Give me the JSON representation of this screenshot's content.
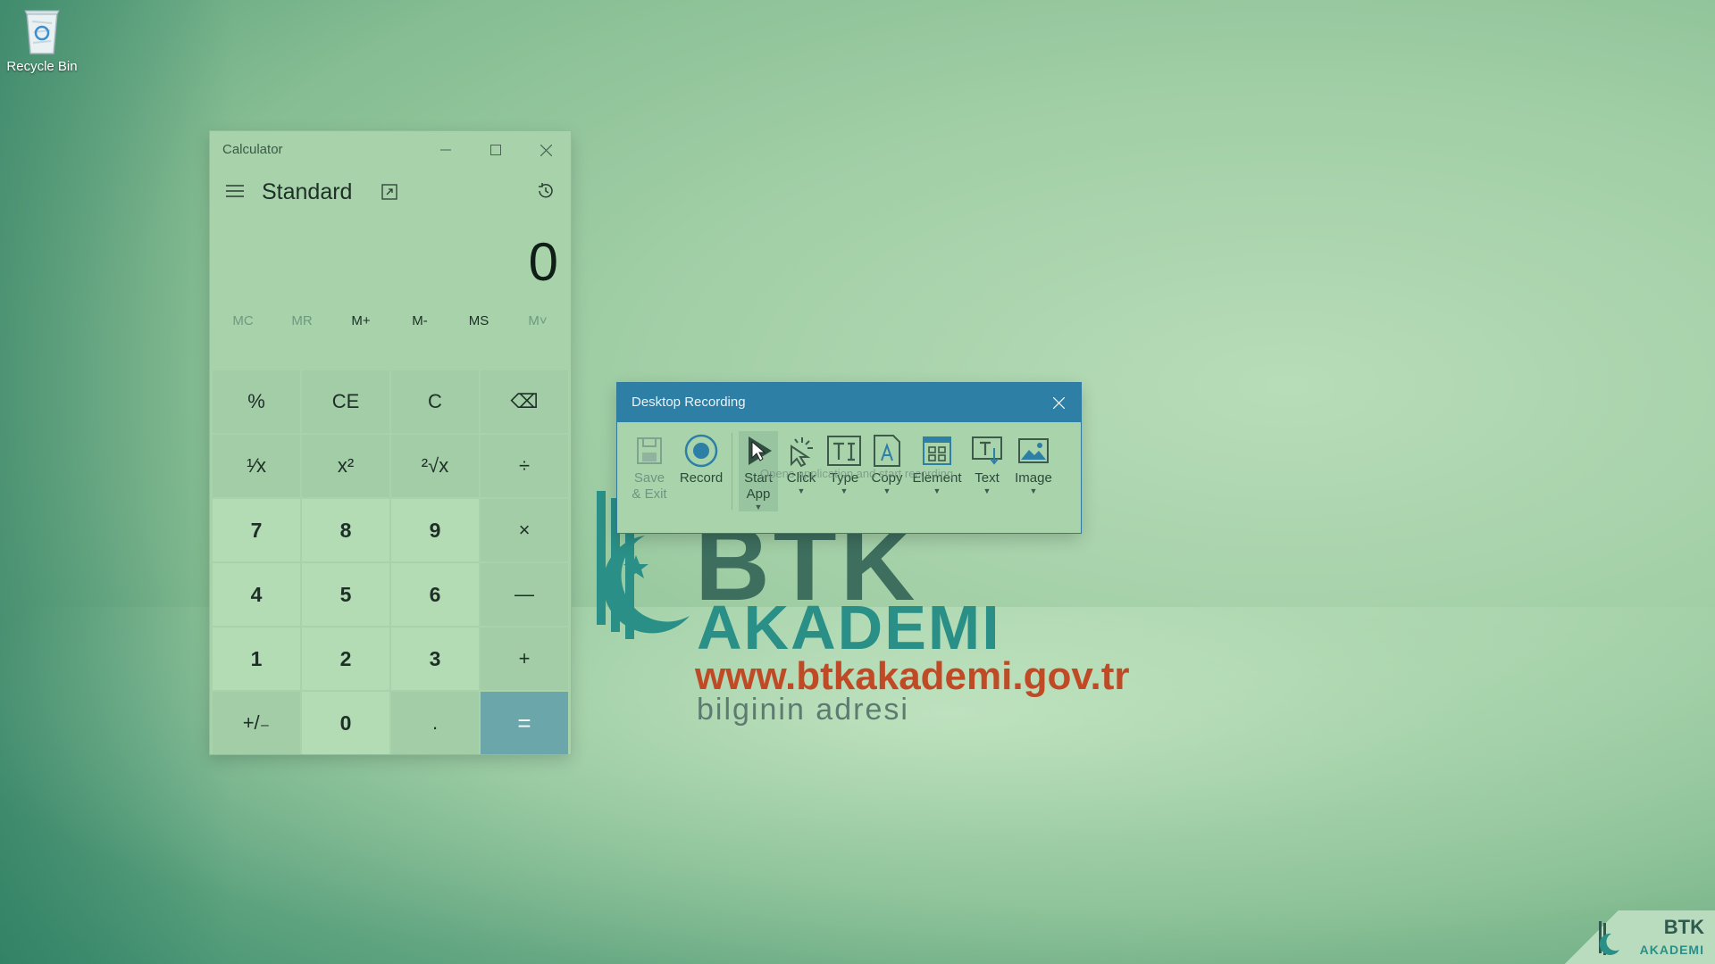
{
  "desktop": {
    "recycle_bin_label": "Recycle Bin"
  },
  "logo": {
    "btk": "BTK",
    "akademi": "AKADEMI",
    "url": "www.btkakademi.gov.tr",
    "slogan": "bilginin adresi"
  },
  "corner_logo": {
    "btk": "BTK",
    "akademi": "AKADEMI"
  },
  "calculator": {
    "title": "Calculator",
    "mode": "Standard",
    "display_value": "0",
    "memory": [
      "MC",
      "MR",
      "M+",
      "M-",
      "MS",
      "M˅"
    ],
    "keys": [
      {
        "label": "%",
        "type": "op"
      },
      {
        "label": "CE",
        "type": "op"
      },
      {
        "label": "C",
        "type": "op"
      },
      {
        "label": "⌫",
        "type": "op"
      },
      {
        "label": "¹⁄x",
        "type": "op"
      },
      {
        "label": "x²",
        "type": "op"
      },
      {
        "label": "²√x",
        "type": "op"
      },
      {
        "label": "÷",
        "type": "op"
      },
      {
        "label": "7",
        "type": "num"
      },
      {
        "label": "8",
        "type": "num"
      },
      {
        "label": "9",
        "type": "num"
      },
      {
        "label": "×",
        "type": "op"
      },
      {
        "label": "4",
        "type": "num"
      },
      {
        "label": "5",
        "type": "num"
      },
      {
        "label": "6",
        "type": "num"
      },
      {
        "label": "—",
        "type": "op"
      },
      {
        "label": "1",
        "type": "num"
      },
      {
        "label": "2",
        "type": "num"
      },
      {
        "label": "3",
        "type": "num"
      },
      {
        "label": "+",
        "type": "op"
      },
      {
        "label": "+/₋",
        "type": "op"
      },
      {
        "label": "0",
        "type": "num"
      },
      {
        "label": ".",
        "type": "op"
      },
      {
        "label": "=",
        "type": "eq"
      }
    ],
    "accent_color": "#6aa6aa"
  },
  "recorder": {
    "title": "Desktop Recording",
    "tools": {
      "save_exit": "Save & Exit",
      "record": "Record",
      "start_app": "Start App",
      "click": "Click",
      "type": "Type",
      "copy": "Copy",
      "element": "Element",
      "text": "Text",
      "image": "Image"
    },
    "tooltip": "Opens application and start recording",
    "accent_color": "#2d7fa6"
  }
}
